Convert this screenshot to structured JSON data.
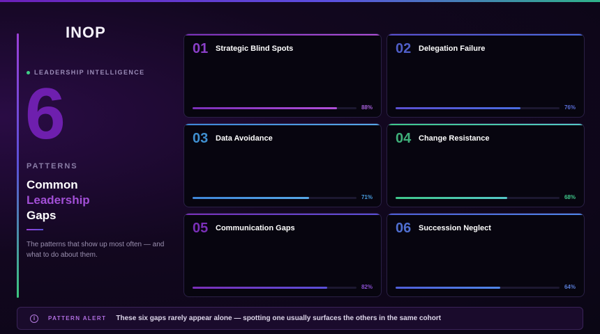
{
  "brand": "INOP",
  "tag": "LEADERSHIP INTELLIGENCE",
  "big_number": "6",
  "patterns_label": "PATTERNS",
  "headline": {
    "line1": "Common",
    "line2": "Leadership",
    "line3": "Gaps"
  },
  "description": "The patterns that show up most often — and what to do about them.",
  "colors": {
    "accent_purple": "#9b3fd8",
    "accent_blue": "#5a52d8",
    "accent_green": "#3fcf86"
  },
  "cards": [
    {
      "num": "01",
      "title": "Strategic Blind Spots",
      "pct": "88%",
      "value": 0.88,
      "num_color": "#8a3fc8",
      "bar": "linear-gradient(90deg,#7a2fb8,#b04fd8)",
      "pct_color": "#a55fd8",
      "accent": "linear-gradient(90deg,#7a2fb8,#b04fd8)"
    },
    {
      "num": "02",
      "title": "Delegation Failure",
      "pct": "76%",
      "value": 0.76,
      "num_color": "#4f5ec8",
      "bar": "linear-gradient(90deg,#5a4fd0,#4a6ce0)",
      "pct_color": "#5a6ed8",
      "accent": "linear-gradient(90deg,#5a4fd0,#4a6ce0)"
    },
    {
      "num": "03",
      "title": "Data Avoidance",
      "pct": "71%",
      "value": 0.71,
      "num_color": "#3f8fd0",
      "bar": "linear-gradient(90deg,#3f86d8,#57a8e8)",
      "pct_color": "#4a9ee0",
      "accent": "linear-gradient(90deg,#3f86d8,#57a8e8)"
    },
    {
      "num": "04",
      "title": "Change Resistance",
      "pct": "68%",
      "value": 0.68,
      "num_color": "#3fb07a",
      "bar": "linear-gradient(90deg,#3fc78a,#55c8c8)",
      "pct_color": "#3fc78a",
      "accent": "linear-gradient(90deg,#3fc78a,#55c8c8)"
    },
    {
      "num": "05",
      "title": "Communication Gaps",
      "pct": "82%",
      "value": 0.82,
      "num_color": "#7a2fb8",
      "bar": "linear-gradient(90deg,#7a2fb8,#5a4fd8)",
      "pct_color": "#8a4fd0",
      "accent": "linear-gradient(90deg,#7a2fb8,#5a4fd8)"
    },
    {
      "num": "06",
      "title": "Succession Neglect",
      "pct": "64%",
      "value": 0.64,
      "num_color": "#4f6ed0",
      "bar": "linear-gradient(90deg,#4f5ed8,#4f86e8)",
      "pct_color": "#5a7ed8",
      "accent": "linear-gradient(90deg,#4f5ed8,#4f86e8)"
    }
  ],
  "alert": {
    "icon": "info-icon",
    "label": "PATTERN ALERT",
    "text": "These six gaps rarely appear alone — spotting one usually surfaces the others in the same cohort"
  }
}
